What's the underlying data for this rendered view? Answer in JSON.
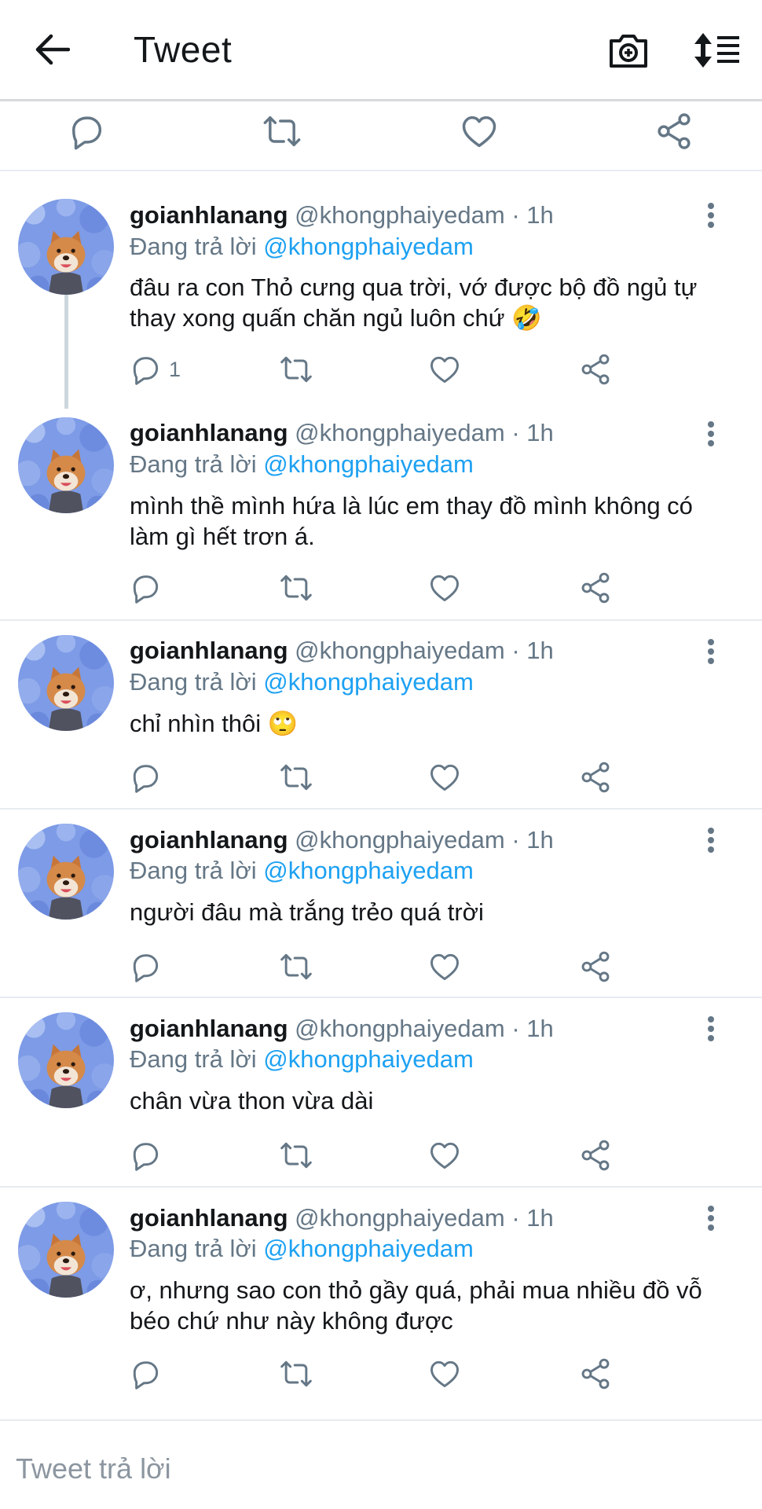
{
  "header": {
    "title": "Tweet",
    "icons": [
      "arrow-left-icon",
      "camera-plus-icon",
      "sort-icon"
    ]
  },
  "colors": {
    "accent": "#1da1f2",
    "muted": "#657786",
    "icon": "#657786",
    "divider": "#e6ecf0"
  },
  "tweets": [
    {
      "username": "goianhlanang",
      "handle_time": "@khongphaiyedam · 1h",
      "reply_prefix": "Đang trả lời",
      "reply_to": "@khongphaiyedam",
      "text": "đâu ra con Thỏ cưng qua trời, vớ được bộ đồ ngủ tự thay xong quấn chăn ngủ luôn chứ 🤣",
      "reply_count": "1"
    },
    {
      "username": "goianhlanang",
      "handle_time": "@khongphaiyedam · 1h",
      "reply_prefix": "Đang trả lời",
      "reply_to": "@khongphaiyedam",
      "text": "mình thề mình hứa là lúc em thay đồ mình không có làm gì hết trơn á."
    },
    {
      "username": "goianhlanang",
      "handle_time": "@khongphaiyedam · 1h",
      "reply_prefix": "Đang trả lời",
      "reply_to": "@khongphaiyedam",
      "text": "chỉ nhìn thôi 🙄"
    },
    {
      "username": "goianhlanang",
      "handle_time": "@khongphaiyedam · 1h",
      "reply_prefix": "Đang trả lời",
      "reply_to": "@khongphaiyedam",
      "text": "người đâu mà trắng trẻo quá trời"
    },
    {
      "username": "goianhlanang",
      "handle_time": "@khongphaiyedam · 1h",
      "reply_prefix": "Đang trả lời",
      "reply_to": "@khongphaiyedam",
      "text": "chân vừa thon vừa dài"
    },
    {
      "username": "goianhlanang",
      "handle_time": "@khongphaiyedam · 1h",
      "reply_prefix": "Đang trả lời",
      "reply_to": "@khongphaiyedam",
      "text": "ơ, nhưng sao con thỏ gầy quá, phải mua nhiều đồ vỗ béo chứ như này không được"
    }
  ],
  "compose": {
    "placeholder": "Tweet trả lời"
  }
}
